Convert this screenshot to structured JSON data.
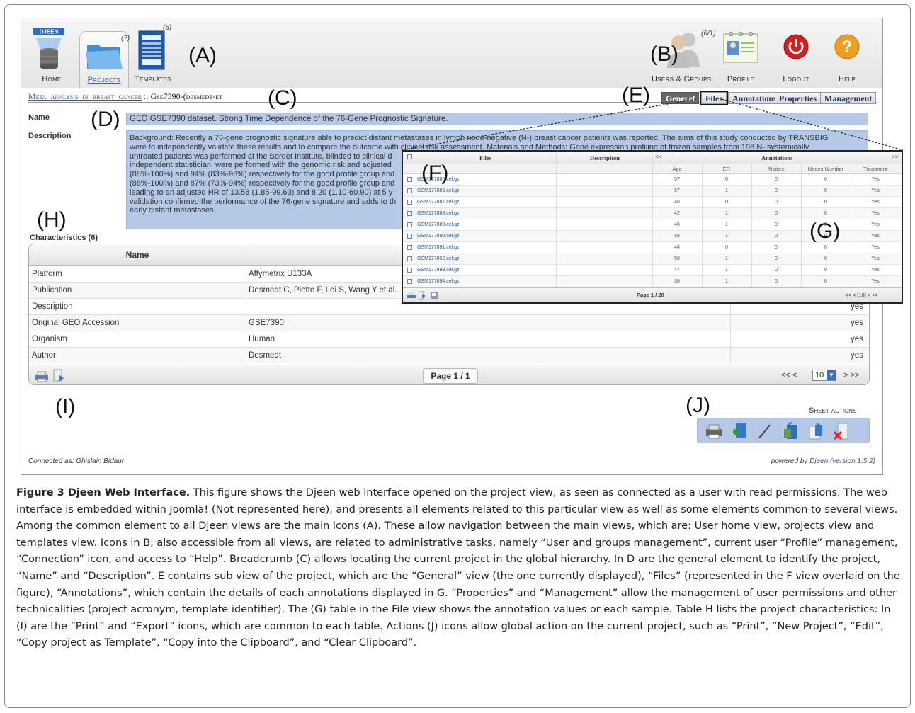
{
  "app": {
    "logo_text": "DJEEN",
    "nav": [
      {
        "id": "home",
        "label": "Home",
        "count": ""
      },
      {
        "id": "projects",
        "label": "Projects",
        "count": "(7)"
      },
      {
        "id": "templates",
        "label": "Templates",
        "count": "(5)"
      }
    ],
    "right_nav": [
      {
        "id": "users",
        "label": "Users & Groups",
        "count": "(6/1)"
      },
      {
        "id": "profile",
        "label": "Profile"
      },
      {
        "id": "logout",
        "label": "Logout"
      },
      {
        "id": "help",
        "label": "Help"
      }
    ]
  },
  "breadcrumb": {
    "project": "Meta_analysis_in_breast_cancer",
    "separator": " :: ",
    "current": "Gse7390-(desmedt-et"
  },
  "tabs": [
    "General",
    "Files",
    "Annotations",
    "Properties",
    "Management"
  ],
  "active_tab": "General",
  "fields": {
    "name_label": "Name",
    "name_value": "GEO GSE7390 dataset. Strong Time Dependence of the 76-Gene Prognostic Signature.",
    "description_label": "Description",
    "description_lines": [
      "Background: Recently a 76-gene prognostic signature able to predict distant metastases in lymph node-negative (N-) breast cancer patients was reported. The aims of this study conducted by TRANSBIG",
      "were to independently validate these results and to compare the outcome with clinical risk assessment. Materials and Methods: Gene expression profiling of frozen samples from 198 N- systemically",
      "untreated patients was performed at the Bordet Institute, blinded to clinical d",
      "independent statistician, were performed with the genomic risk and adjusted",
      "(88%-100%) and 94% (83%-98%) respectively for the good profile group and",
      "(88%-100%) and 87% (73%-94%) respectively for the good profile group and",
      "leading to an adjusted HR of 13.58 (1.85-99.63) and 8.20 (1.10-60.90) at 5 y",
      "validation confirmed the performance of the 76-gene signature and adds to th",
      "early distant metastases."
    ]
  },
  "characteristics": {
    "title": "Characteristics (6)",
    "header_name": "Name",
    "rows": [
      {
        "name": "Platform",
        "value": "Affymetrix U133A",
        "flag": ""
      },
      {
        "name": "Publication",
        "value": "Desmedt C, Piette F, Loi S, Wang Y et al.",
        "flag": ""
      },
      {
        "name": "Description",
        "value": "",
        "flag": "yes"
      },
      {
        "name": "Original GEO Accession",
        "value": "GSE7390",
        "flag": "yes"
      },
      {
        "name": "Organism",
        "value": "Human",
        "flag": "yes"
      },
      {
        "name": "Author",
        "value": "Desmedt",
        "flag": "yes"
      }
    ],
    "page": "Page 1 / 1",
    "pager_prev": "<<  <",
    "pager_next": ">   >>",
    "page_size": "10"
  },
  "sheet_actions": {
    "label": "Sheet actions"
  },
  "footer": {
    "connected": "Connected as: Ghislain Bidaut",
    "powered_prefix": "powered by ",
    "powered_link": "Djeen (version 1.5.2)"
  },
  "files_panel": {
    "header_files": "Files",
    "header_description": "Description",
    "header_annotations": "Annotations",
    "nav_left": "<<",
    "nav_right": ">>",
    "subheaders": [
      "Age",
      "ER",
      "Nodes",
      "Nodes Number",
      "Treatment"
    ],
    "rows": [
      {
        "file": "GSM177885.cel.gz",
        "age": "57",
        "er": "0",
        "nodes": "0",
        "nn": "0",
        "tr": "Yes"
      },
      {
        "file": "GSM177886.cel.gz",
        "age": "57",
        "er": "1",
        "nodes": "0",
        "nn": "0",
        "tr": "Yes"
      },
      {
        "file": "GSM177887.cel.gz",
        "age": "48",
        "er": "0",
        "nodes": "0",
        "nn": "0",
        "tr": "Yes"
      },
      {
        "file": "GSM177888.cel.gz",
        "age": "42",
        "er": "1",
        "nodes": "0",
        "nn": "0",
        "tr": "Yes"
      },
      {
        "file": "GSM177889.cel.gz",
        "age": "46",
        "er": "1",
        "nodes": "0",
        "nn": "0",
        "tr": "Yes"
      },
      {
        "file": "GSM177890.cel.gz",
        "age": "58",
        "er": "1",
        "nodes": "0",
        "nn": "0",
        "tr": "Yes"
      },
      {
        "file": "GSM177891.cel.gz",
        "age": "44",
        "er": "0",
        "nodes": "0",
        "nn": "0",
        "tr": "Yes"
      },
      {
        "file": "GSM177892.cel.gz",
        "age": "58",
        "er": "1",
        "nodes": "0",
        "nn": "0",
        "tr": "Yes"
      },
      {
        "file": "GSM177893.cel.gz",
        "age": "47",
        "er": "1",
        "nodes": "0",
        "nn": "0",
        "tr": "Yes"
      },
      {
        "file": "GSM177894.cel.gz",
        "age": "38",
        "er": "1",
        "nodes": "0",
        "nn": "0",
        "tr": "Yes"
      }
    ],
    "page": "Page 1 / 20",
    "pager": "<<  <  [10]  >  >>"
  },
  "labels": {
    "A": "(A)",
    "B": "(B)",
    "C": "(C)",
    "D": "(D)",
    "E": "(E)",
    "F": "(F)",
    "G": "(G)",
    "H": "(H)",
    "I": "(I)",
    "J": "(J)"
  },
  "caption": {
    "title": "Figure 3 Djeen Web Interface.",
    "text": " This figure shows the Djeen web interface opened on the project view, as seen as connected as a user with read permissions. The web interface is embedded within Joomla! (Not represented here), and presents all elements related to this particular view as well as some elements common to several views. Among the common element to all Djeen views are the main icons (A). These allow navigation between the main views, which are: User home view, projects view and templates view. Icons in B, also accessible from all views, are related to administrative tasks, namely “User and groups management”, current user “Profile” management, “Connection” icon, and access to “Help”. Breadcrumb (C) allows locating the current project in the global hierarchy. In D are the general element to identify the project, “Name” and “Description”. E contains sub view of the project, which are the “General” view (the one currently displayed), “Files” (represented in the F view overlaid on the figure), “Annotations”, which contain the details of each annotations displayed in G. “Properties” and “Management” allow the management of user permissions and other technicalities (project acronym, template identifier). The (G) table in the File view shows the annotation values or each sample. Table H lists the project characteristics: In (I) are the “Print” and “Export” icons, which are common to each table. Actions (J) icons allow global action on the current project, such as “Print”, “New Project”, “Edit”, “Copy project as Template”, “Copy into the Clipboard”, and “Clear Clipboard”."
  }
}
